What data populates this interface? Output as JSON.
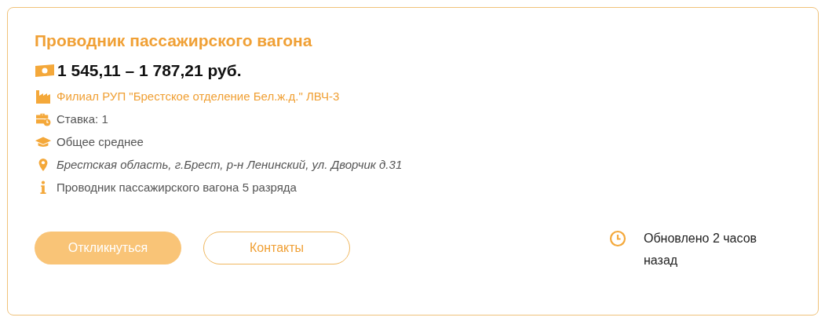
{
  "vacancy": {
    "title": "Проводник пассажирского вагона",
    "salary": "1 545,11 – 1 787,21 руб.",
    "details": [
      {
        "kind": "employer",
        "text": "Филиал РУП \"Брестское отделение Бел.ж.д.\" ЛВЧ-3"
      },
      {
        "kind": "rate",
        "text": "Ставка: 1"
      },
      {
        "kind": "education",
        "text": "Общее среднее"
      },
      {
        "kind": "address",
        "text": "Брестская область, г.Брест, р-н Ленинский, ул. Дворчик д.31"
      },
      {
        "kind": "info",
        "text": "Проводник пассажирского вагона 5 разряда"
      }
    ],
    "buttons": [
      {
        "kind": "primary",
        "label": "Откликнуться"
      },
      {
        "kind": "outline",
        "label": "Контакты"
      }
    ],
    "updated": "Обновлено 2 часов назад"
  }
}
